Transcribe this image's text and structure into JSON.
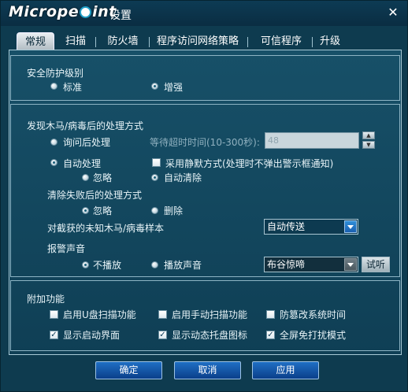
{
  "window": {
    "logo_left": "Micrope",
    "logo_right": "int",
    "title": "设置",
    "close": "✕"
  },
  "tabs": [
    "常规",
    "扫描",
    "防火墙",
    "程序访问网络策略",
    "可信程序",
    "升级"
  ],
  "security_level": {
    "title": "安全防护级别",
    "options": [
      {
        "label": "标准",
        "selected": false
      },
      {
        "label": "增强",
        "selected": true
      }
    ]
  },
  "trojan": {
    "title": "发现木马/病毒后的处理方式",
    "ask_label": "询问后处理",
    "ask_selected": false,
    "timeout_label": "等待超时时间(10-300秒):",
    "timeout_value": "48",
    "auto_label": "自动处理",
    "auto_selected": true,
    "silent_label": "采用静默方式(处理时不弹出警示框通知)",
    "silent_checked": false,
    "ignore_label": "忽略",
    "ignore_selected": false,
    "auto_clear_label": "自动清除",
    "auto_clear_selected": true,
    "fail_title": "清除失败后的处理方式",
    "fail_ignore": "忽略",
    "fail_ignore_selected": true,
    "fail_delete": "删除",
    "fail_delete_selected": false,
    "sample_label": "对截获的未知木马/病毒样本",
    "sample_value": "自动传送",
    "alarm_title": "报警声音",
    "no_play": "不播放",
    "no_play_selected": true,
    "play": "播放声音",
    "play_selected": false,
    "sound_value": "布谷惊啼",
    "listen": "试听"
  },
  "extra": {
    "title": "附加功能",
    "items": [
      {
        "label": "启用U盘扫描功能",
        "checked": false
      },
      {
        "label": "启用手动扫描功能",
        "checked": false
      },
      {
        "label": "防篡改系统时间",
        "checked": false
      },
      {
        "label": "显示启动界面",
        "checked": true
      },
      {
        "label": "显示动态托盘图标",
        "checked": true
      },
      {
        "label": "全屏免打扰模式",
        "checked": true
      }
    ]
  },
  "buttons": {
    "ok": "确定",
    "cancel": "取消",
    "apply": "应用"
  },
  "colors": {
    "background": "#0e3b4f",
    "accent": "#1f6fc4",
    "text": "#e8f4f8"
  }
}
